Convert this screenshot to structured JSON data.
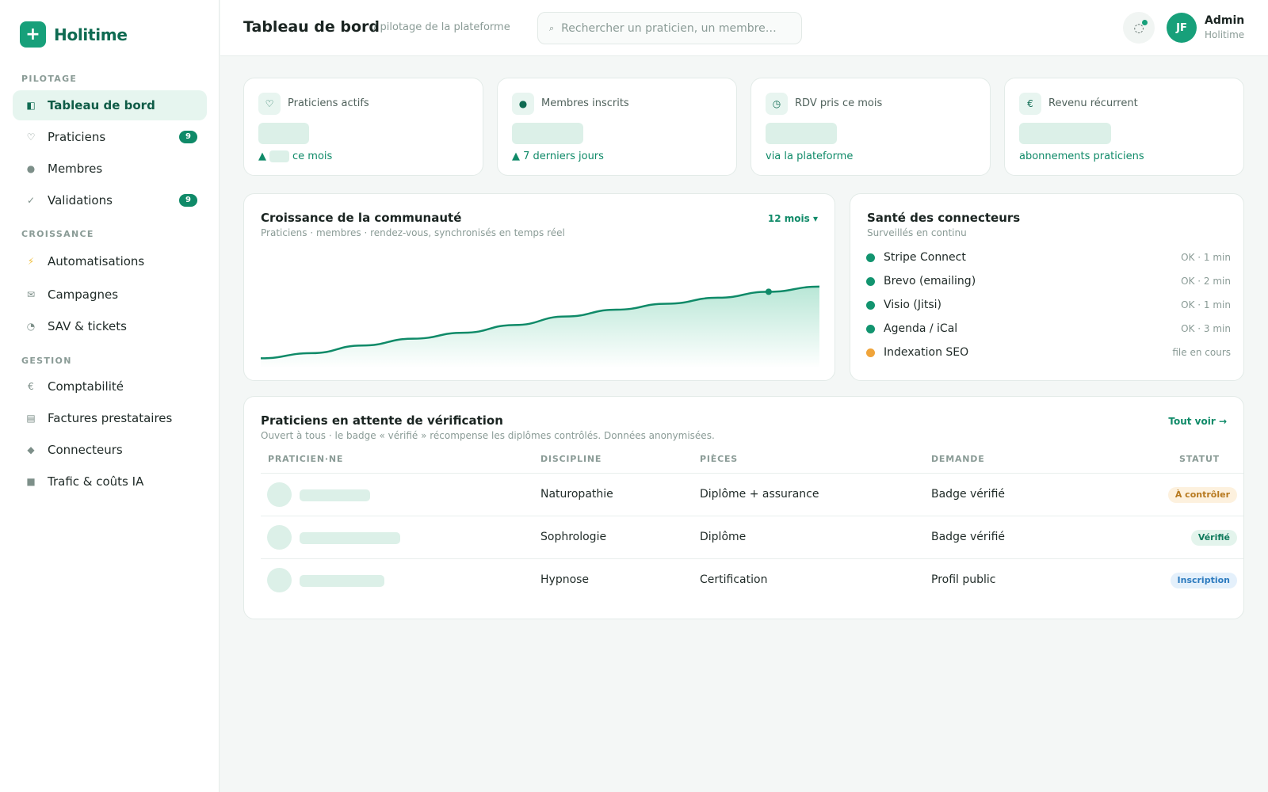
{
  "brand": {
    "name": "Holitime",
    "logo_icon": "plus-cross-icon"
  },
  "sidebar": {
    "sections": [
      {
        "title": "PILOTAGE",
        "items": [
          {
            "label": "Tableau de bord",
            "icon": "dashboard-icon",
            "active": true
          },
          {
            "label": "Praticiens",
            "icon": "heart-icon",
            "badge": "9"
          },
          {
            "label": "Membres",
            "icon": "members-icon"
          },
          {
            "label": "Validations",
            "icon": "check-icon",
            "badge": "9"
          }
        ]
      },
      {
        "title": "CROISSANCE",
        "items": [
          {
            "label": "Automatisations",
            "icon": "bolt-icon"
          },
          {
            "label": "Campagnes",
            "icon": "mail-icon"
          },
          {
            "label": "SAV & tickets",
            "icon": "support-icon"
          }
        ]
      },
      {
        "title": "GESTION",
        "items": [
          {
            "label": "Comptabilité",
            "icon": "euro-icon"
          },
          {
            "label": "Factures prestataires",
            "icon": "invoice-icon"
          },
          {
            "label": "Connecteurs",
            "icon": "diamond-icon"
          },
          {
            "label": "Trafic & coûts IA",
            "icon": "chart-icon"
          }
        ]
      }
    ]
  },
  "header": {
    "title": "Tableau de bord",
    "subtitle": "/ pilotage de la plateforme",
    "search_placeholder": "Rechercher un praticien, un membre…",
    "user": {
      "initials": "JF",
      "name": "Admin",
      "org": "Holitime"
    }
  },
  "kpis": [
    {
      "label": "Praticiens actifs",
      "icon": "heart-icon",
      "foot_prefix": "▲",
      "foot": "ce mois"
    },
    {
      "label": "Membres inscrits",
      "icon": "members-icon",
      "foot": "▲ 7 derniers jours"
    },
    {
      "label": "RDV pris ce mois",
      "icon": "clock-icon",
      "foot": "via la plateforme"
    },
    {
      "label": "Revenu récurrent",
      "icon": "euro-icon",
      "foot": "abonnements praticiens"
    }
  ],
  "growth": {
    "title": "Croissance de la communauté",
    "subtitle": "Praticiens · membres · rendez-vous, synchronisés en temps réel",
    "range": "12 mois ▾",
    "accent": "#0f8a68"
  },
  "chart_data": {
    "type": "area",
    "x": [
      1,
      2,
      3,
      4,
      5,
      6,
      7,
      8,
      9,
      10,
      11,
      12
    ],
    "values": [
      8,
      14,
      23,
      31,
      38,
      47,
      57,
      65,
      72,
      79,
      86,
      92
    ],
    "highlight_index": 10,
    "ylim": [
      0,
      130
    ],
    "grid": false
  },
  "connectors": {
    "title": "Santé des connecteurs",
    "subtitle": "Surveillés en continu",
    "items": [
      {
        "name": "Stripe Connect",
        "status": "OK · 1 min",
        "color": "#12946f"
      },
      {
        "name": "Brevo (emailing)",
        "status": "OK · 2 min",
        "color": "#12946f"
      },
      {
        "name": "Visio (Jitsi)",
        "status": "OK · 1 min",
        "color": "#12946f"
      },
      {
        "name": "Agenda / iCal",
        "status": "OK · 3 min",
        "color": "#12946f"
      },
      {
        "name": "Indexation SEO",
        "status": "file en cours",
        "color": "#f0a43a"
      }
    ]
  },
  "pending": {
    "title": "Praticiens en attente de vérification",
    "subtitle": "Ouvert à tous · le badge « vérifié » récompense les diplômes contrôlés. Données anonymisées.",
    "link": "Tout voir →",
    "columns": [
      "PRATICIEN·NE",
      "DISCIPLINE",
      "PIÈCES",
      "DEMANDE",
      "STATUT"
    ],
    "rows": [
      {
        "discipline": "Naturopathie",
        "pieces": "Diplôme + assurance",
        "demande": "Badge vérifié",
        "statut": "À contrôler",
        "statut_bg": "#fdf1de",
        "statut_fg": "#b7791f"
      },
      {
        "discipline": "Sophrologie",
        "pieces": "Diplôme",
        "demande": "Badge vérifié",
        "statut": "Vérifié",
        "statut_bg": "#e3f4ec",
        "statut_fg": "#0f7a5c"
      },
      {
        "discipline": "Hypnose",
        "pieces": "Certification",
        "demande": "Profil public",
        "statut": "Inscription",
        "statut_bg": "#e4f0fb",
        "statut_fg": "#2d7bbf"
      }
    ]
  }
}
